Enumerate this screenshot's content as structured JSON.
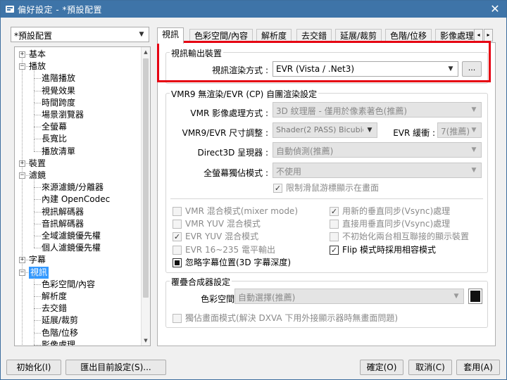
{
  "window": {
    "title": "偏好設定 - *預設配置",
    "close_glyph": "✕"
  },
  "profile": {
    "value": "*預設配置"
  },
  "tree": [
    {
      "label": "基本",
      "level": 0,
      "expander": "+"
    },
    {
      "label": "播放",
      "level": 0,
      "expander": "−"
    },
    {
      "label": "進階播放",
      "level": 1
    },
    {
      "label": "視覺效果",
      "level": 1
    },
    {
      "label": "時間跨度",
      "level": 1
    },
    {
      "label": "場景瀏覽器",
      "level": 1
    },
    {
      "label": "全螢幕",
      "level": 1
    },
    {
      "label": "長寬比",
      "level": 1
    },
    {
      "label": "播放清單",
      "level": 1
    },
    {
      "label": "裝置",
      "level": 0,
      "expander": "+"
    },
    {
      "label": "濾鏡",
      "level": 0,
      "expander": "−"
    },
    {
      "label": "來源濾鏡/分離器",
      "level": 1
    },
    {
      "label": "內建 OpenCodec",
      "level": 1
    },
    {
      "label": "視訊解碼器",
      "level": 1
    },
    {
      "label": "音訊解碼器",
      "level": 1
    },
    {
      "label": "全域濾鏡優先權",
      "level": 1
    },
    {
      "label": "個人濾鏡優先權",
      "level": 1
    },
    {
      "label": "字幕",
      "level": 0,
      "expander": "+"
    },
    {
      "label": "視訊",
      "level": 0,
      "expander": "−",
      "selected": true
    },
    {
      "label": "色彩空間/內容",
      "level": 1
    },
    {
      "label": "解析度",
      "level": 1
    },
    {
      "label": "去交錯",
      "level": 1
    },
    {
      "label": "延展/裁剪",
      "level": 1
    },
    {
      "label": "色階/位移",
      "level": 1
    },
    {
      "label": "影像處理",
      "level": 1
    }
  ],
  "tabs": [
    "視訊",
    "色彩空間/內容",
    "解析度",
    "去交錯",
    "延展/裁剪",
    "色階/位移",
    "影像處理"
  ],
  "tab_scroll": {
    "left": "◂",
    "right": "▸"
  },
  "output_device": {
    "title": "視訊輸出裝置",
    "renderer_label": "視訊渲染方式 :",
    "renderer_value": "EVR (Vista / .Net3)",
    "more_button": "..."
  },
  "vmr9": {
    "title": "VMR9 無渲染/EVR (CP) 自團渲染設定",
    "mode_label": "VMR 影像處理方式 :",
    "mode_value": "3D 紋理層 - 僅用於像素著色(推薦)",
    "resize_label": "VMR9/EVR 尺寸調整 :",
    "resize_value": "Shader(2 PASS) Bicubic(/",
    "buffer_label": "EVR 緩衝 :",
    "buffer_value": "7(推薦)",
    "d3d_label": "Direct3D 呈現器 :",
    "d3d_value": "自動偵測(推薦)",
    "exclusive_label": "全螢幕獨佔模式 :",
    "exclusive_value": "不使用",
    "limit_cursor": "限制滑鼠游標顯示在畫面"
  },
  "checkboxes": {
    "mixer": "VMR 混合模式(mixer mode)",
    "new_vsync": "用新的垂直同步(Vsync)處理",
    "yuv_mix": "VMR YUV 混合模式",
    "direct_vsync": "直接用垂直同步(Vsync)處理",
    "evr_yuv": "EVR YUV 混合模式",
    "no_init": "不初始化兩台相互聯接的顯示裝置",
    "evr_16": "EVR 16~235 電平輸出",
    "flip": "Flip 模式時採用相容模式",
    "ignore_sub": "忽略字幕位置(3D 字幕深度)"
  },
  "overlay": {
    "title": "覆疊合成器設定",
    "color_label": "色彩空間 :",
    "color_value": "自動選擇(推薦)",
    "exclusive": "獨佔畫面模式(解決 DXVA 下用外接顯示器時無畫面問題)"
  },
  "footer": {
    "init": "初始化(I)",
    "export": "匯出目前設定(S)...",
    "ok": "確定(O)",
    "cancel": "取消(C)",
    "apply": "套用(A)"
  },
  "colors": {
    "title_bg": "#3e74a8",
    "highlight": "#e60012",
    "selection": "#3399ff"
  }
}
